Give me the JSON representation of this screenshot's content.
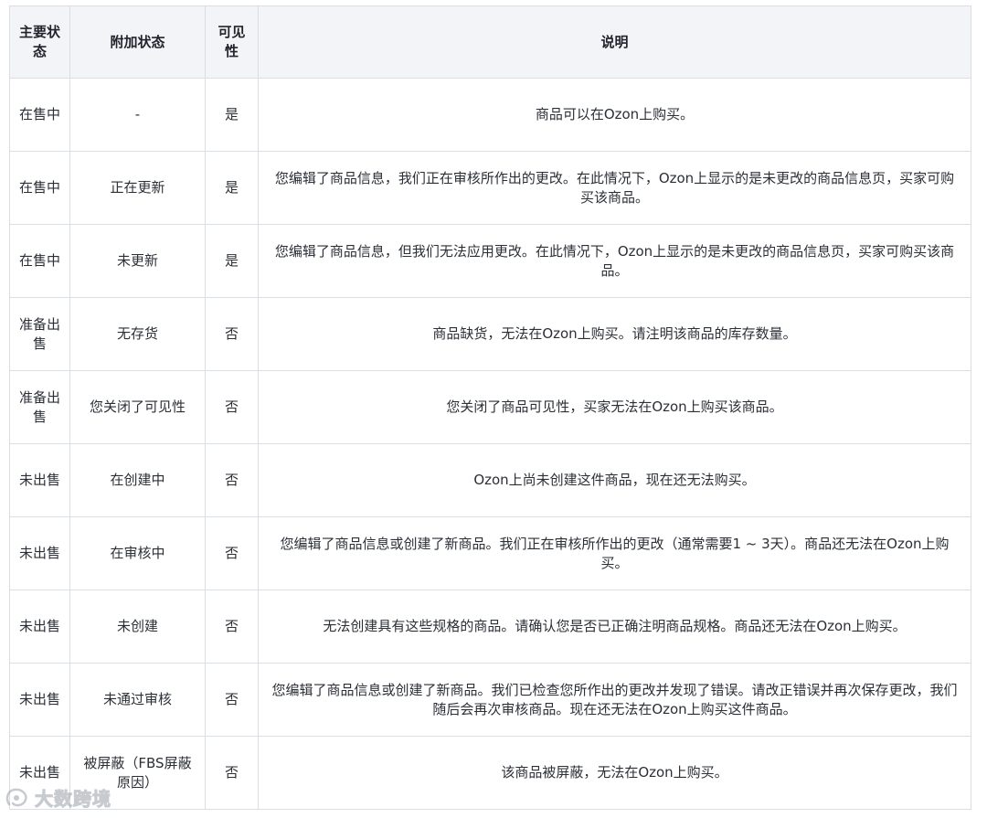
{
  "table": {
    "headers": [
      "主要状态",
      "附加状态",
      "可见性",
      "说明"
    ],
    "rows": [
      {
        "status": "在售中",
        "extra": "-",
        "visible": "是",
        "desc": "商品可以在Ozon上购买。"
      },
      {
        "status": "在售中",
        "extra": "正在更新",
        "visible": "是",
        "desc": "您编辑了商品信息，我们正在审核所作出的更改。在此情况下，Ozon上显示的是未更改的商品信息页，买家可购买该商品。"
      },
      {
        "status": "在售中",
        "extra": "未更新",
        "visible": "是",
        "desc": "您编辑了商品信息，但我们无法应用更改。在此情况下，Ozon上显示的是未更改的商品信息页，买家可购买该商品。"
      },
      {
        "status": "准备出售",
        "extra": "无存货",
        "visible": "否",
        "desc": "商品缺货，无法在Ozon上购买。请注明该商品的库存数量。"
      },
      {
        "status": "准备出售",
        "extra": "您关闭了可见性",
        "visible": "否",
        "desc": "您关闭了商品可见性，买家无法在Ozon上购买该商品。"
      },
      {
        "status": "未出售",
        "extra": "在创建中",
        "visible": "否",
        "desc": "Ozon上尚未创建这件商品，现在还无法购买。"
      },
      {
        "status": "未出售",
        "extra": "在审核中",
        "visible": "否",
        "desc": "您编辑了商品信息或创建了新商品。我们正在审核所作出的更改（通常需要1 ~ 3天）。商品还无法在Ozon上购买。"
      },
      {
        "status": "未出售",
        "extra": "未创建",
        "visible": "否",
        "desc": "无法创建具有这些规格的商品。请确认您是否已正确注明商品规格。商品还无法在Ozon上购买。"
      },
      {
        "status": "未出售",
        "extra": "未通过审核",
        "visible": "否",
        "desc": "您编辑了商品信息或创建了新商品。我们已检查您所作出的更改并发现了错误。请改正错误并再次保存更改，我们随后会再次审核商品。现在还无法在Ozon上购买这件商品。"
      },
      {
        "status": "未出售",
        "extra": "被屏蔽（FBS屏蔽原因）",
        "visible": "否",
        "desc": "该商品被屏蔽，无法在Ozon上购买。"
      }
    ]
  },
  "watermark": {
    "text": "大数跨境",
    "icon": "brand-logo-icon"
  }
}
